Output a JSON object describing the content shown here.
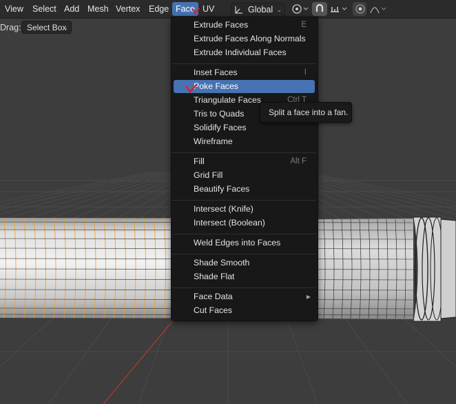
{
  "header": {
    "menus": [
      {
        "label": "View"
      },
      {
        "label": "Select"
      },
      {
        "label": "Add"
      },
      {
        "label": "Mesh"
      },
      {
        "label": "Vertex"
      },
      {
        "label": "Edge"
      },
      {
        "label": "Face",
        "active": true
      },
      {
        "label": "UV"
      }
    ],
    "orientation_label": "Global",
    "orientation_icon": "transform-orientation-icon",
    "pivot_icon": "pivot-point-icon",
    "snap_icon": "snap-magnet-icon",
    "snap_target_icon": "snap-increment-icon",
    "proportional_icon": "proportional-editing-icon",
    "falloff_icon": "falloff-curve-icon",
    "active_color": "#4772b3"
  },
  "tool_settings": {
    "drag_label": "Drag:",
    "drag_value": "Select Box"
  },
  "face_menu": {
    "items": [
      {
        "label": "Extrude Faces",
        "shortcut": "E"
      },
      {
        "label": "Extrude Faces Along Normals",
        "shortcut": ""
      },
      {
        "label": "Extrude Individual Faces",
        "shortcut": ""
      },
      {
        "label": "Inset Faces",
        "shortcut": "I"
      },
      {
        "label": "Poke Faces",
        "shortcut": "",
        "highlighted": true
      },
      {
        "label": "Triangulate Faces",
        "shortcut": "Ctrl T"
      },
      {
        "label": "Tris to Quads",
        "shortcut": ""
      },
      {
        "label": "Solidify Faces",
        "shortcut": ""
      },
      {
        "label": "Wireframe",
        "shortcut": ""
      },
      {
        "label": "Fill",
        "shortcut": "Alt F"
      },
      {
        "label": "Grid Fill",
        "shortcut": ""
      },
      {
        "label": "Beautify Faces",
        "shortcut": ""
      },
      {
        "label": "Intersect (Knife)",
        "shortcut": ""
      },
      {
        "label": "Intersect (Boolean)",
        "shortcut": ""
      },
      {
        "label": "Weld Edges into Faces",
        "shortcut": ""
      },
      {
        "label": "Shade Smooth",
        "shortcut": ""
      },
      {
        "label": "Shade Flat",
        "shortcut": ""
      },
      {
        "label": "Face Data",
        "shortcut": "",
        "submenu": true
      },
      {
        "label": "Cut Faces",
        "shortcut": ""
      }
    ]
  },
  "tooltip": {
    "text": "Split a face into a fan."
  },
  "colors": {
    "viewport_bg": "#3d3d3d",
    "mesh_fill": "#d9d9d9",
    "selected_edge": "#f5a623",
    "x_axis": "#c0392b",
    "annotation_mark": "#e02020"
  }
}
